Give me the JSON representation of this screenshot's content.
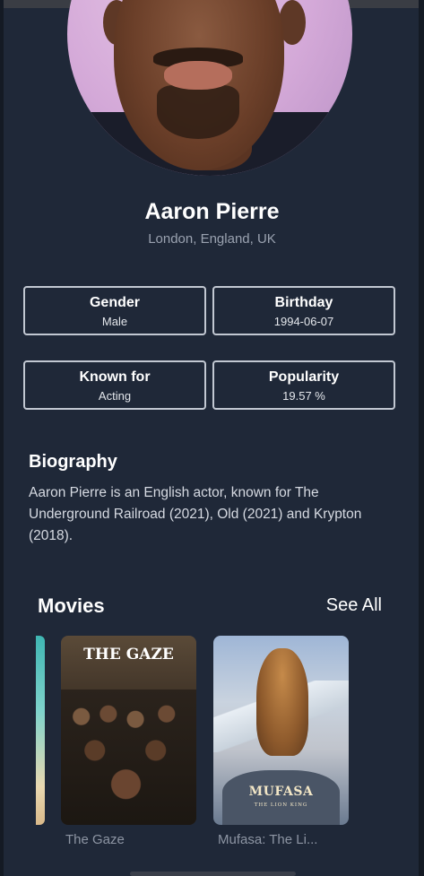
{
  "profile": {
    "name": "Aaron Pierre",
    "location": "London, England, UK"
  },
  "info_cards": [
    {
      "title": "Gender",
      "value": "Male"
    },
    {
      "title": "Birthday",
      "value": "1994-06-07"
    },
    {
      "title": "Known for",
      "value": "Acting"
    },
    {
      "title": "Popularity",
      "value": "19.57 %"
    }
  ],
  "biography": {
    "heading": "Biography",
    "text": "Aaron Pierre is an English actor, known for The Underground Railroad (2021), Old (2021) and Krypton (2018)."
  },
  "movies": {
    "heading": "Movies",
    "see_all_label": "See All",
    "items": [
      {
        "title": "The Gaze",
        "poster_text": "THE GAZE"
      },
      {
        "title": "Mufasa: The Li...",
        "poster_text": "MUFASA",
        "poster_subtext": "THE LION KING"
      }
    ]
  },
  "colors": {
    "background": "#1f2838",
    "card_border": "#c2c8d2",
    "muted_text": "#9aa2b0"
  }
}
